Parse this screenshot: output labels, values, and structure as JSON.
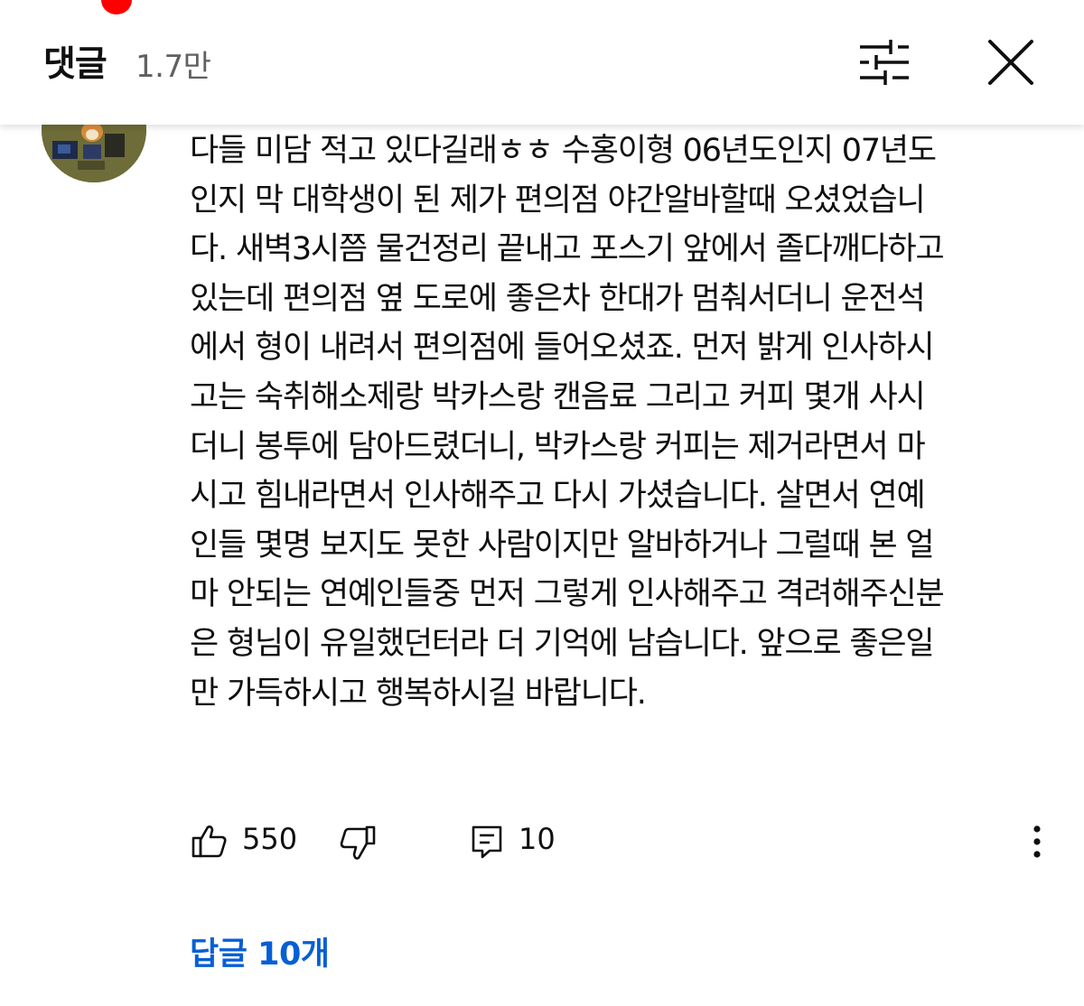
{
  "header": {
    "title": "댓글",
    "count": "1.7만",
    "sort_icon": "sort-filter-icon",
    "close_icon": "close-icon"
  },
  "comment": {
    "avatar_icon": "avatar-image",
    "lines": [
      "다들 미담 적고 있다길래ㅎㅎ 수홍이형 06년도인지 07년도",
      "인지 막 대학생이 된 제가 편의점 야간알바할때 오셨었습니",
      "다. 새벽3시쯤 물건정리 끝내고 포스기 앞에서 졸다깨다하고",
      "있는데 편의점 옆 도로에 좋은차 한대가 멈춰서더니 운전석",
      "에서 형이 내려서 편의점에 들어오셨죠. 먼저 밝게 인사하시",
      "고는 숙취해소제랑 박카스랑 캔음료 그리고 커피 몇개 사시",
      "더니 봉투에 담아드렸더니, 박카스랑 커피는 제거라면서 마",
      "시고 힘내라면서 인사해주고 다시 가셨습니다. 살면서 연예",
      "인들 몇명 보지도 못한 사람이지만 알바하거나 그럴때 본 얼",
      "마 안되는 연예인들중 먼저 그렇게 인사해주고 격려해주신분",
      "은 형님이 유일했던터라 더 기억에 남습니다. 앞으로 좋은일",
      "만 가득하시고 행복하시길 바랍니다."
    ],
    "likes": "550",
    "reply_count": "10",
    "replies_link": "답글 10개"
  },
  "colors": {
    "accent_link": "#065fd4",
    "notification_dot": "#ff0000",
    "secondary_text": "#606060"
  }
}
